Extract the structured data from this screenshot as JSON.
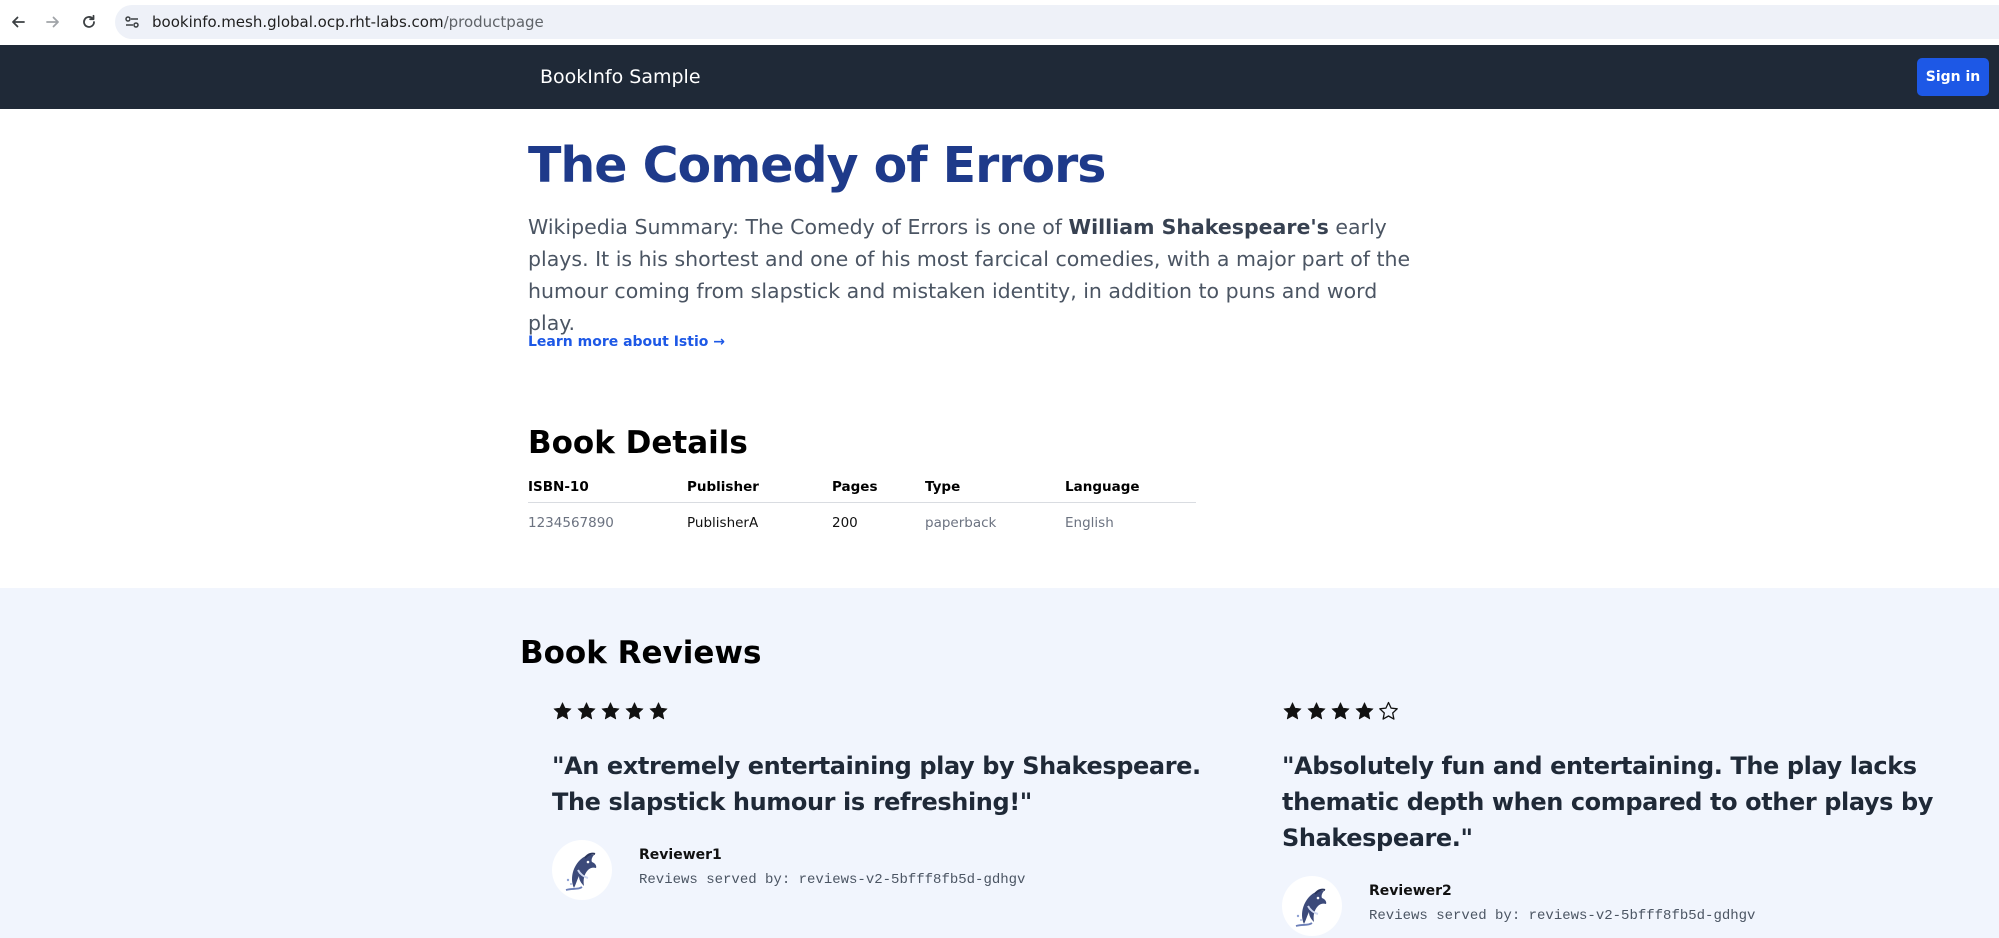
{
  "browser": {
    "url_host": "bookinfo.mesh.global.ocp.rht-labs.com",
    "url_path": "/productpage"
  },
  "navbar": {
    "brand": "BookInfo Sample",
    "sign_in": "Sign in"
  },
  "hero": {
    "title": "The Comedy of Errors",
    "summary_prefix": "Wikipedia Summary: The Comedy of Errors is one of ",
    "summary_bold": "William Shakespeare's",
    "summary_suffix": " early plays. It is his shortest and one of his most farcical comedies, with a major part of the humour coming from slapstick and mistaken identity, in addition to puns and word play.",
    "learn_more": "Learn more about Istio →"
  },
  "details": {
    "title": "Book Details",
    "headers": [
      "ISBN-10",
      "Publisher",
      "Pages",
      "Type",
      "Language"
    ],
    "row": [
      "1234567890",
      "PublisherA",
      "200",
      "paperback",
      "English"
    ]
  },
  "reviews": {
    "title": "Book Reviews",
    "items": [
      {
        "rating": 5,
        "text": "\"An extremely entertaining play by Shakespeare. The slapstick humour is refreshing!\"",
        "reviewer": "Reviewer1",
        "served_by": "Reviews served by: reviews-v2-5bfff8fb5d-gdhgv"
      },
      {
        "rating": 4,
        "text": "\"Absolutely fun and entertaining. The play lacks thematic depth when compared to other plays by Shakespeare.\"",
        "reviewer": "Reviewer2",
        "served_by": "Reviews served by: reviews-v2-5bfff8fb5d-gdhgv"
      }
    ]
  },
  "colors": {
    "navbar_bg": "#1f2937",
    "title_blue": "#1e3a8a",
    "accent_blue": "#1d58e6",
    "reviews_bg": "#f1f5fd"
  },
  "icons": [
    "back-arrow-icon",
    "forward-arrow-icon",
    "reload-icon",
    "site-settings-icon",
    "star-icon",
    "star-outline-icon",
    "dolphin-avatar-icon"
  ]
}
